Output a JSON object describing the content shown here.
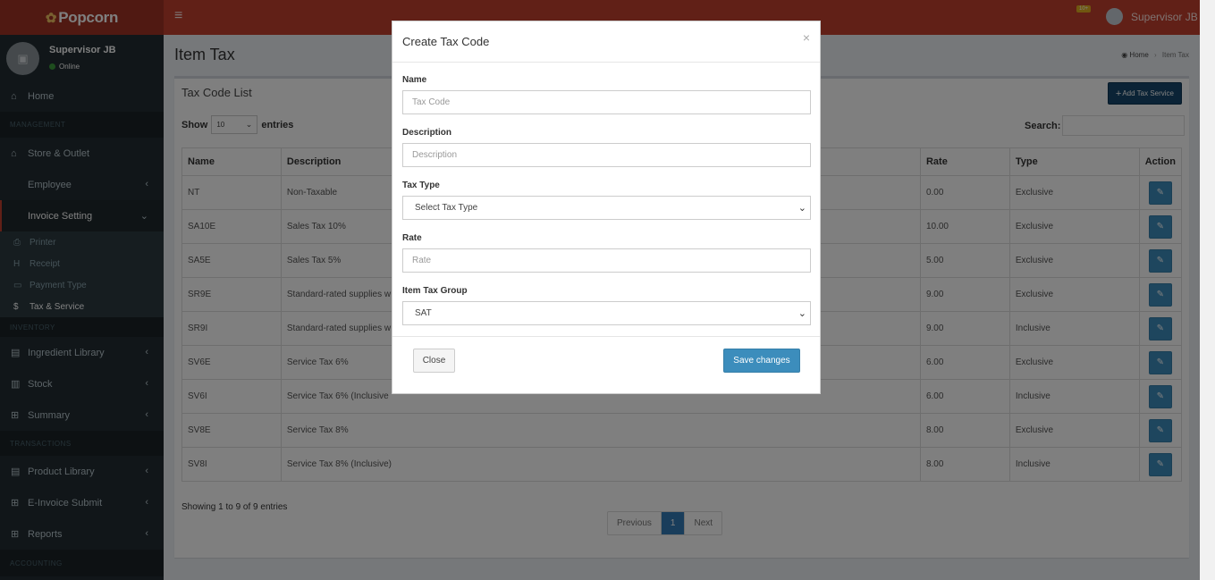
{
  "brand": {
    "name": "Popcorn"
  },
  "header": {
    "notif_badge": "10+",
    "user": "Supervisor JB"
  },
  "sidebar": {
    "user_name": "Supervisor JB",
    "user_status": "Online",
    "home": "Home",
    "header_management": "MANAGEMENT",
    "store_outlet": "Store & Outlet",
    "employee": "Employee",
    "invoice_setting": "Invoice Setting",
    "sub": [
      "Printer",
      "Receipt",
      "Payment Type",
      "Tax & Service"
    ],
    "header_inventory": "INVENTORY",
    "ingredient_library": "Ingredient Library",
    "stock": "Stock",
    "summary": "Summary",
    "header_transactions": "TRANSACTIONS",
    "product_library": "Product Library",
    "einvoice": "E-Invoice Submit",
    "reports": "Reports",
    "header_accounting": "ACCOUNTING"
  },
  "page": {
    "title": "Item Tax",
    "breadcrumb_home": "Home",
    "breadcrumb_current": "Item Tax"
  },
  "box": {
    "title": "Tax Code List",
    "add_button": "Add Tax Service",
    "show_label": "Show",
    "entries_value": "10",
    "entries_label": "entries",
    "search_label": "Search:",
    "columns": [
      "Name",
      "Description",
      "Rate",
      "Type",
      "Action"
    ],
    "rows": [
      {
        "name": "NT",
        "description": "Non-Taxable",
        "rate": "0.00",
        "type": "Exclusive"
      },
      {
        "name": "SA10E",
        "description": "Sales Tax 10%",
        "rate": "10.00",
        "type": "Exclusive"
      },
      {
        "name": "SA5E",
        "description": "Sales Tax 5%",
        "rate": "5.00",
        "type": "Exclusive"
      },
      {
        "name": "SR9E",
        "description": "Standard-rated supplies w",
        "rate": "9.00",
        "type": "Exclusive"
      },
      {
        "name": "SR9I",
        "description": "Standard-rated supplies w",
        "rate": "9.00",
        "type": "Inclusive"
      },
      {
        "name": "SV6E",
        "description": "Service Tax 6%",
        "rate": "6.00",
        "type": "Exclusive"
      },
      {
        "name": "SV6I",
        "description": "Service Tax 6% (Inclusive",
        "rate": "6.00",
        "type": "Inclusive"
      },
      {
        "name": "SV8E",
        "description": "Service Tax 8%",
        "rate": "8.00",
        "type": "Exclusive"
      },
      {
        "name": "SV8I",
        "description": "Service Tax 8% (Inclusive)",
        "rate": "8.00",
        "type": "Inclusive"
      }
    ],
    "info": "Showing 1 to 9 of 9 entries",
    "pager": {
      "prev": "Previous",
      "page": "1",
      "next": "Next"
    }
  },
  "modal": {
    "title": "Create Tax Code",
    "close_x": "×",
    "name_label": "Name",
    "name_placeholder": "Tax Code",
    "description_label": "Description",
    "description_placeholder": "Description",
    "tax_type_label": "Tax Type",
    "tax_type_value": "Select Tax Type",
    "rate_label": "Rate",
    "rate_placeholder": "Rate",
    "group_label": "Item Tax Group",
    "group_value": "SAT",
    "close_button": "Close",
    "save_button": "Save changes"
  }
}
